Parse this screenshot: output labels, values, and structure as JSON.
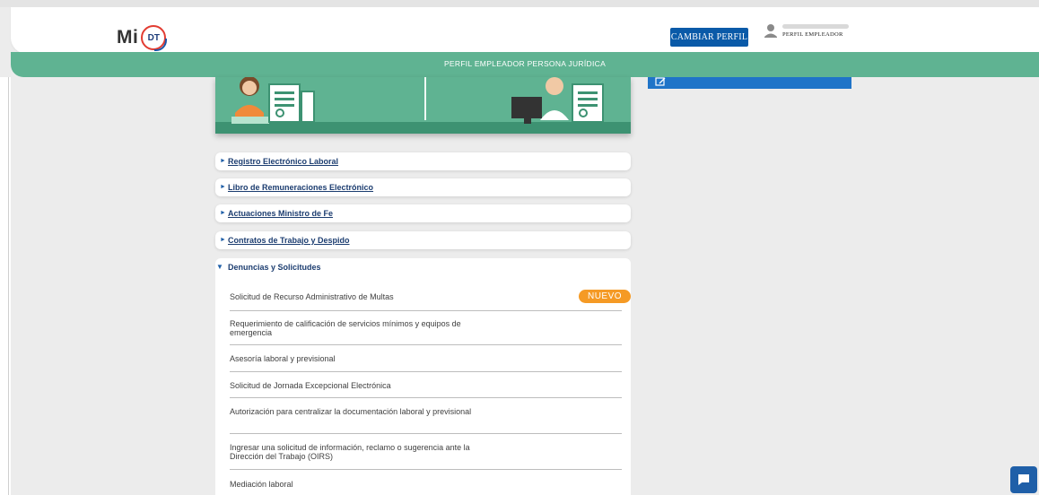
{
  "header": {
    "logo_mi": "Mi",
    "logo_dt": "DT",
    "change_profile_label": "CAMBIAR PERFIL",
    "user_role": "PERFIL EMPLEADOR"
  },
  "profile_bar": {
    "title": "PERFIL EMPLEADOR PERSONA JURÍDICA"
  },
  "menu": {
    "items": [
      {
        "label": "Registro Electrónico Laboral"
      },
      {
        "label": "Libro de Remuneraciones Electrónico"
      },
      {
        "label": "Actuaciones Ministro de Fe"
      },
      {
        "label": "Contratos de Trabajo y Despido"
      }
    ],
    "open_section": {
      "label": "Denuncias y Solicitudes",
      "sub_items": [
        {
          "label": "Solicitud de Recurso Administrativo de Multas",
          "badge": "NUEVO"
        },
        {
          "label": "Requerimiento de calificación de servicios mínimos y equipos de emergencia"
        },
        {
          "label": "Asesoría laboral y previsional"
        },
        {
          "label": "Solicitud de Jornada Excepcional Electrónica"
        },
        {
          "label": "Autorización para centralizar la documentación laboral y previsional"
        },
        {
          "label": "Ingresar una solicitud de información, reclamo o sugerencia ante la Dirección del Trabajo (OIRS)"
        },
        {
          "label": "Mediación laboral"
        }
      ]
    }
  },
  "icons": {
    "user": "user-icon",
    "edit": "edit-icon",
    "chat": "chat-icon",
    "arrow": "caret-right-icon",
    "arrow_open": "caret-down-icon"
  },
  "colors": {
    "green": "#5fb392",
    "blue": "#0a5aa8",
    "badge": "#f59a25",
    "link": "#1c3d70"
  }
}
